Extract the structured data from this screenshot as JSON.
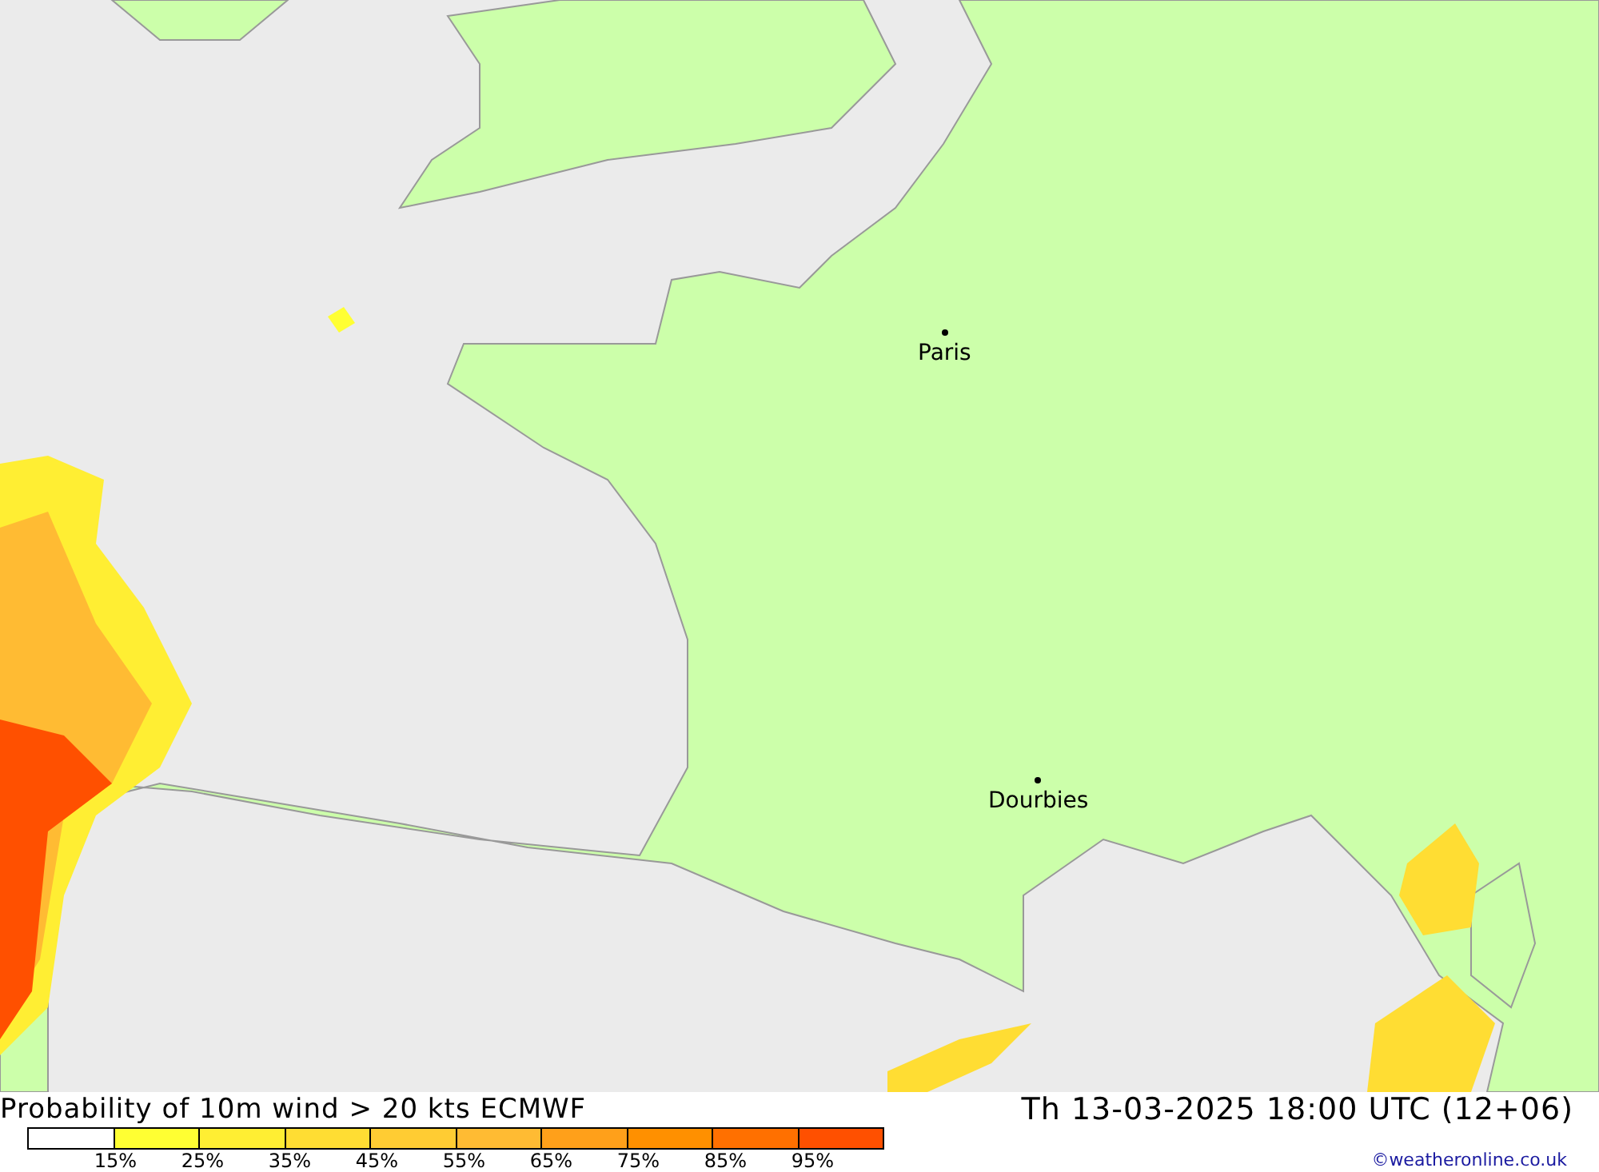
{
  "map": {
    "places": [
      {
        "name": "Paris"
      },
      {
        "name": "Dourbies"
      }
    ]
  },
  "title": "Probability of 10m wind > 20 kts ECMWF",
  "valid_time": "Th 13-03-2025 18:00 UTC (12+06)",
  "legend": {
    "swatches": [
      {
        "color": "#ffffff"
      },
      {
        "color": "#ffff33"
      },
      {
        "color": "#ffee33"
      },
      {
        "color": "#ffdd33"
      },
      {
        "color": "#ffcc33"
      },
      {
        "color": "#ffbb33"
      },
      {
        "color": "#ffa01a"
      },
      {
        "color": "#ff9000"
      },
      {
        "color": "#ff7000"
      },
      {
        "color": "#ff5000"
      }
    ],
    "labels": [
      "15%",
      "25%",
      "35%",
      "45%",
      "55%",
      "65%",
      "75%",
      "85%",
      "95%"
    ]
  },
  "credit": "©weatheronline.co.uk"
}
